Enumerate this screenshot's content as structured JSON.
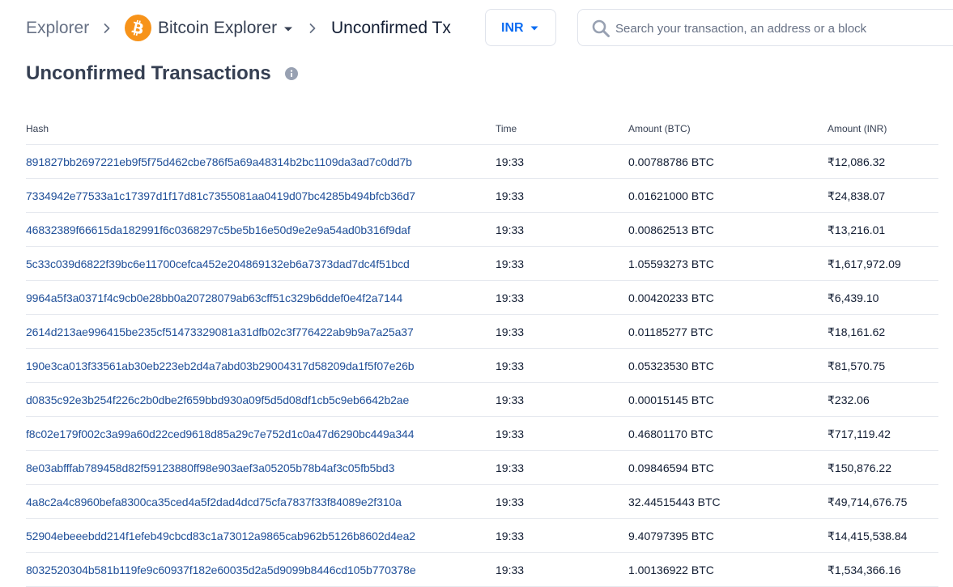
{
  "breadcrumb": {
    "root": "Explorer",
    "chain": "Bitcoin Explorer",
    "current": "Unconfirmed Tx"
  },
  "currency": {
    "selected": "INR"
  },
  "search": {
    "placeholder": "Search your transaction, an address or a block"
  },
  "page": {
    "title": "Unconfirmed Transactions"
  },
  "table": {
    "headers": {
      "hash": "Hash",
      "time": "Time",
      "amount_btc": "Amount (BTC)",
      "amount_inr": "Amount (INR)"
    },
    "rows": [
      {
        "hash": "891827bb2697221eb9f5f75d462cbe786f5a69a48314b2bc1109da3ad7c0dd7b",
        "time": "19:33",
        "btc": "0.00788786 BTC",
        "inr": "₹12,086.32"
      },
      {
        "hash": "7334942e77533a1c17397d1f17d81c7355081aa0419d07bc4285b494bfcb36d7",
        "time": "19:33",
        "btc": "0.01621000 BTC",
        "inr": "₹24,838.07"
      },
      {
        "hash": "46832389f66615da182991f6c0368297c5be5b16e50d9e2e9a54ad0b316f9daf",
        "time": "19:33",
        "btc": "0.00862513 BTC",
        "inr": "₹13,216.01"
      },
      {
        "hash": "5c33c039d6822f39bc6e11700cefca452e204869132eb6a7373dad7dc4f51bcd",
        "time": "19:33",
        "btc": "1.05593273 BTC",
        "inr": "₹1,617,972.09"
      },
      {
        "hash": "9964a5f3a0371f4c9cb0e28bb0a20728079ab63cff51c329b6ddef0e4f2a7144",
        "time": "19:33",
        "btc": "0.00420233 BTC",
        "inr": "₹6,439.10"
      },
      {
        "hash": "2614d213ae996415be235cf51473329081a31dfb02c3f776422ab9b9a7a25a37",
        "time": "19:33",
        "btc": "0.01185277 BTC",
        "inr": "₹18,161.62"
      },
      {
        "hash": "190e3ca013f33561ab30eb223eb2d4a7abd03b29004317d58209da1f5f07e26b",
        "time": "19:33",
        "btc": "0.05323530 BTC",
        "inr": "₹81,570.75"
      },
      {
        "hash": "d0835c92e3b254f226c2b0dbe2f659bbd930a09f5d5d08df1cb5c9eb6642b2ae",
        "time": "19:33",
        "btc": "0.00015145 BTC",
        "inr": "₹232.06"
      },
      {
        "hash": "f8c02e179f002c3a99a60d22ced9618d85a29c7e752d1c0a47d6290bc449a344",
        "time": "19:33",
        "btc": "0.46801170 BTC",
        "inr": "₹717,119.42"
      },
      {
        "hash": "8e03abfffab789458d82f59123880ff98e903aef3a05205b78b4af3c05fb5bd3",
        "time": "19:33",
        "btc": "0.09846594 BTC",
        "inr": "₹150,876.22"
      },
      {
        "hash": "4a8c2a4c8960befa8300ca35ced4a5f2dad4dcd75cfa7837f33f84089e2f310a",
        "time": "19:33",
        "btc": "32.44515443 BTC",
        "inr": "₹49,714,676.75"
      },
      {
        "hash": "52904ebeeebdd214f1efeb49cbcd83c1a73012a9865cab962b5126b8602d4ea2",
        "time": "19:33",
        "btc": "9.40797395 BTC",
        "inr": "₹14,415,538.84"
      },
      {
        "hash": "8032520304b581b119fe9c60937f182e60035d2a5d9099b8446cd105b770378e",
        "time": "19:33",
        "btc": "1.00136922 BTC",
        "inr": "₹1,534,366.16"
      }
    ]
  },
  "colors": {
    "link": "#1f4f99",
    "accent": "#0c6cf2",
    "bitcoin": "#f7931a",
    "text": "#121d33",
    "muted": "#677185",
    "border": "#e6e9ef"
  },
  "icons": {
    "bitcoin": "bitcoin-logo-icon",
    "chevron": "chevron-right-icon",
    "caret": "caret-down-icon",
    "search": "search-icon",
    "info": "info-icon"
  }
}
